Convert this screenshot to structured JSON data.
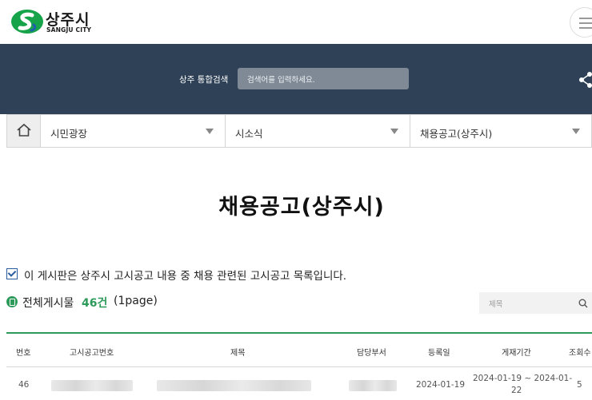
{
  "header": {
    "logo_ko": "상주시",
    "logo_en": "SANGJU CITY",
    "logo_colors": {
      "green": "#17a34a",
      "blue": "#1f5fae"
    },
    "menu_icon": "hamburger-menu-icon"
  },
  "search": {
    "label": "상주 통합검색",
    "placeholder": "검색어를 입력하세요.",
    "share_icon": "share-icon",
    "band_color": "#2e4156"
  },
  "breadcrumb": {
    "home_icon": "home-icon",
    "items": [
      {
        "label": "시민광장"
      },
      {
        "label": "시소식"
      },
      {
        "label": "채용공고(상주시)"
      }
    ]
  },
  "page": {
    "title": "채용공고(상주시)"
  },
  "notice": {
    "text": "이 게시판은 상주시 고시공고 내용 중 채용 관련된 고시공고 목록입니다."
  },
  "board": {
    "count_label": "전체게시물",
    "count_value": "46건",
    "page_info": "(1page)",
    "accent": "#2e9a5a",
    "search_placeholder": "제목"
  },
  "table": {
    "headers": [
      "번호",
      "고시공고번호",
      "제목",
      "담당부서",
      "등록일",
      "게재기간",
      "조회수"
    ],
    "rows": [
      {
        "no": "46",
        "date": "2024-01-19",
        "period_line1": "2024-01-19 ~ 2024-01-",
        "period_line2": "22",
        "views": "5"
      }
    ]
  }
}
